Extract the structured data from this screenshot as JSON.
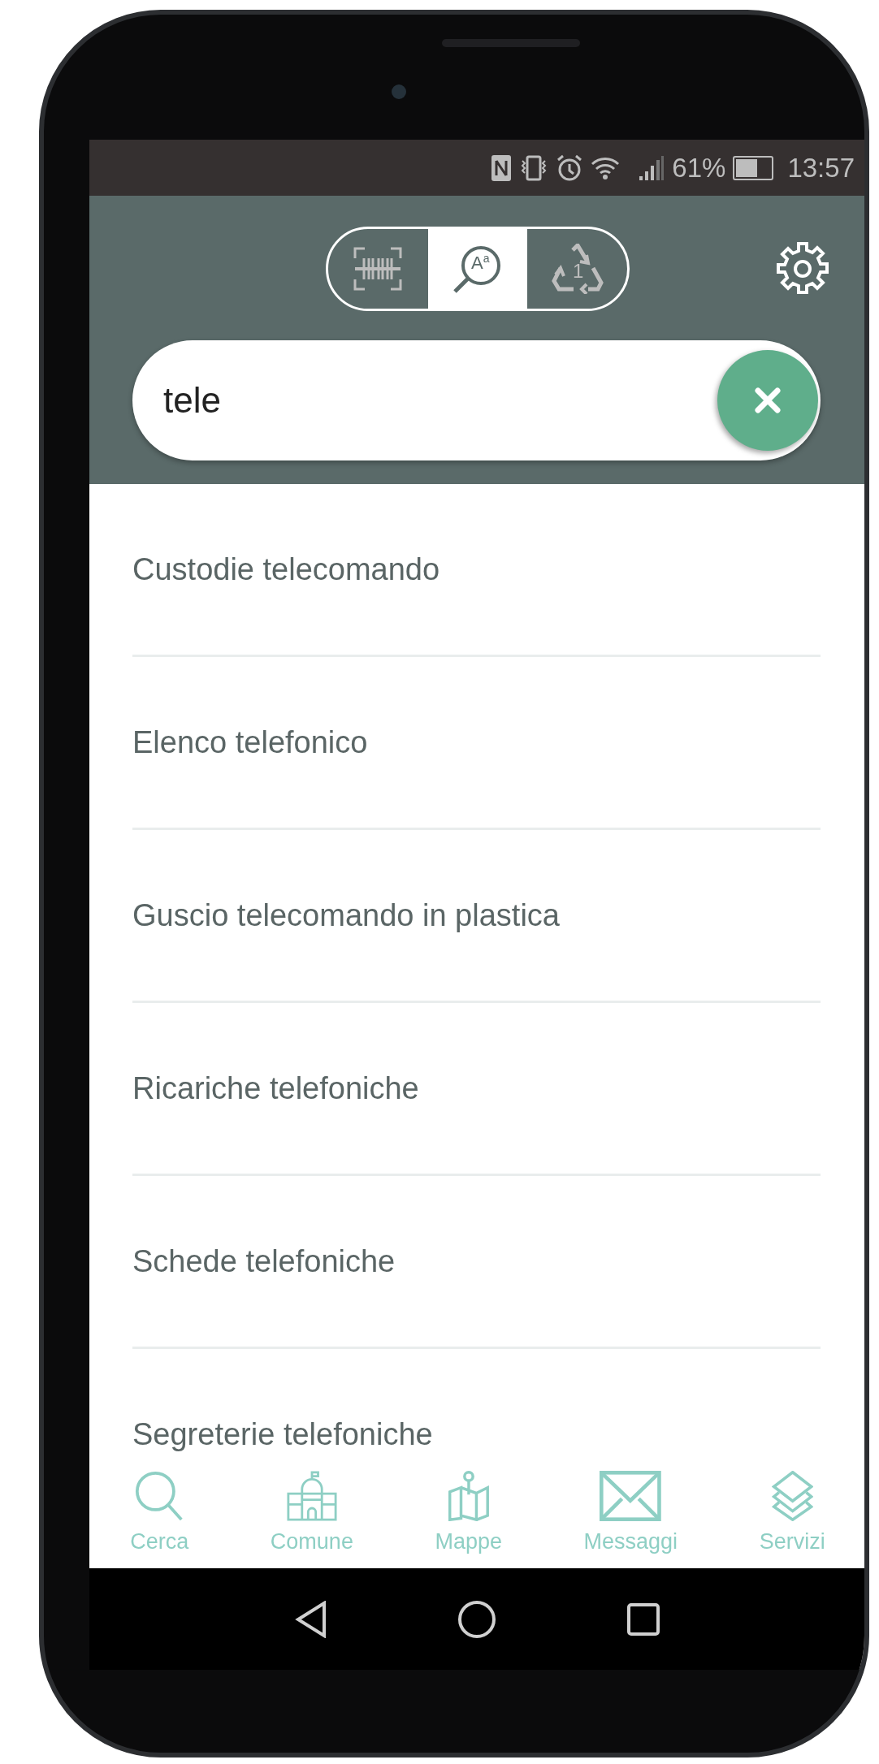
{
  "status_bar": {
    "battery_text": "61%",
    "battery": {
      "level": 0.61
    },
    "time": "13:57"
  },
  "modes": [
    {
      "kind": "barcode",
      "selected": false
    },
    {
      "kind": "text-search",
      "label": "A$^{a}$",
      "selected": true
    },
    {
      "kind": "recycle",
      "label": "1",
      "selected": false
    }
  ],
  "search": {
    "value": "tele"
  },
  "results": [
    "Custodie telecomando",
    "Elenco telefonico",
    "Guscio telecomando in plastica",
    "Ricariche telefoniche",
    "Schede telefoniche",
    "Segreterie telefoniche"
  ],
  "bottom_nav": [
    {
      "kind": "search",
      "label": "Cerca"
    },
    {
      "kind": "town-hall",
      "label": "Comune"
    },
    {
      "kind": "map",
      "label": "Mappe"
    },
    {
      "kind": "mail",
      "label": "Messaggi"
    },
    {
      "kind": "layers",
      "label": "Servizi"
    }
  ]
}
